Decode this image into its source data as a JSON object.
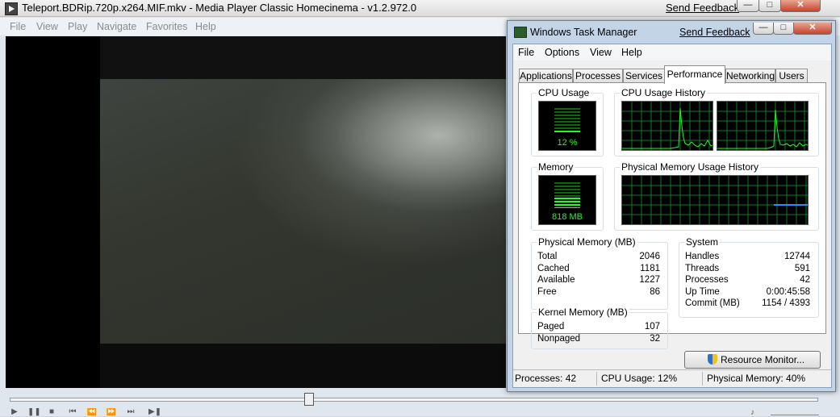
{
  "mpc": {
    "title": "Teleport.BDRip.720p.x264.MIF.mkv - Media Player Classic Homecinema - v1.2.972.0",
    "feedback": "Send Feedback",
    "menu": [
      "File",
      "View",
      "Play",
      "Navigate",
      "Favorites",
      "Help"
    ],
    "seek_position": 0.365
  },
  "tm": {
    "title": "Windows Task Manager",
    "feedback": "Send Feedback",
    "menu": [
      "File",
      "Options",
      "View",
      "Help"
    ],
    "tabs": [
      "Applications",
      "Processes",
      "Services",
      "Performance",
      "Networking",
      "Users"
    ],
    "active_tab": "Performance",
    "cpu": {
      "label": "CPU Usage",
      "value": "12 %",
      "percent": 12
    },
    "cpu_history": {
      "label": "CPU Usage History"
    },
    "memory": {
      "label": "Memory",
      "value": "818 MB",
      "percent": 40
    },
    "mem_history": {
      "label": "Physical Memory Usage History"
    },
    "physical": {
      "label": "Physical Memory (MB)",
      "rows": [
        {
          "k": "Total",
          "v": "2046"
        },
        {
          "k": "Cached",
          "v": "1181"
        },
        {
          "k": "Available",
          "v": "1227"
        },
        {
          "k": "Free",
          "v": "86"
        }
      ]
    },
    "kernel": {
      "label": "Kernel Memory (MB)",
      "rows": [
        {
          "k": "Paged",
          "v": "107"
        },
        {
          "k": "Nonpaged",
          "v": "32"
        }
      ]
    },
    "system": {
      "label": "System",
      "rows": [
        {
          "k": "Handles",
          "v": "12744"
        },
        {
          "k": "Threads",
          "v": "591"
        },
        {
          "k": "Processes",
          "v": "42"
        },
        {
          "k": "Up Time",
          "v": "0:00:45:58"
        },
        {
          "k": "Commit (MB)",
          "v": "1154 / 4393"
        }
      ]
    },
    "resource_button": "Resource Monitor...",
    "status": {
      "processes": "Processes: 42",
      "cpu": "CPU Usage: 12%",
      "memory": "Physical Memory: 40%"
    }
  },
  "colors": {
    "graph_grid": "#0a7d2a",
    "graph_line": "#1dff1d",
    "mem_line": "#2a8cff"
  }
}
